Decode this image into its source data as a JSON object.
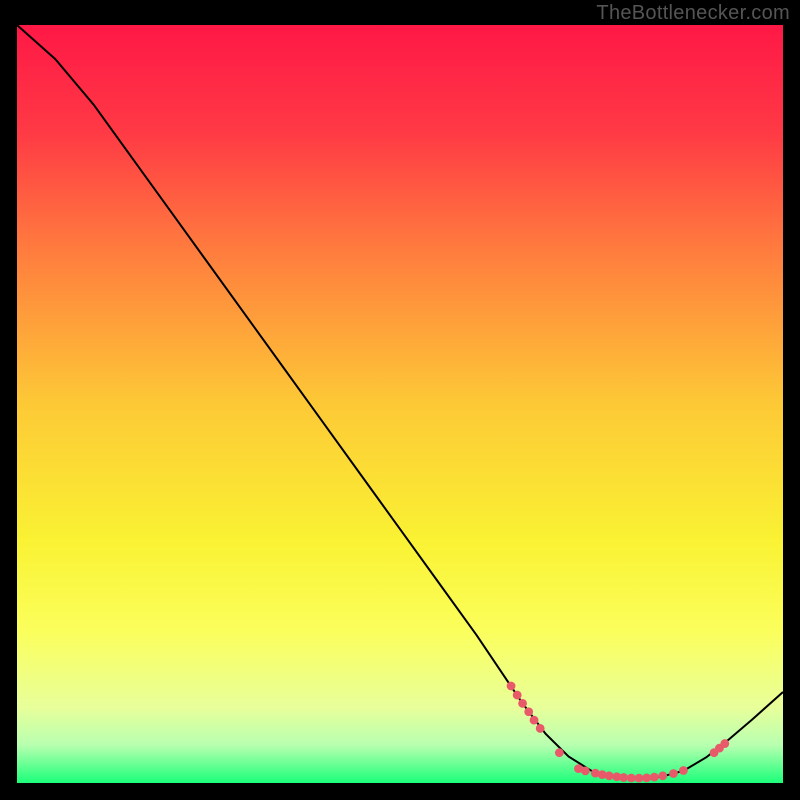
{
  "watermark": "TheBottlenecker.com",
  "chart_data": {
    "type": "line",
    "title": "",
    "xlabel": "",
    "ylabel": "",
    "xlim": [
      0,
      100
    ],
    "ylim": [
      0,
      100
    ],
    "background_gradient": {
      "stops": [
        {
          "offset": 0.0,
          "color": "#ff1846"
        },
        {
          "offset": 0.14,
          "color": "#ff3945"
        },
        {
          "offset": 0.3,
          "color": "#ff7d3e"
        },
        {
          "offset": 0.5,
          "color": "#fdc936"
        },
        {
          "offset": 0.68,
          "color": "#faf233"
        },
        {
          "offset": 0.8,
          "color": "#fbff5c"
        },
        {
          "offset": 0.9,
          "color": "#e8ff9a"
        },
        {
          "offset": 0.95,
          "color": "#b8ffb0"
        },
        {
          "offset": 1.0,
          "color": "#1bff7a"
        }
      ]
    },
    "series": [
      {
        "name": "curve",
        "color": "#000000",
        "points": [
          {
            "x": 0,
            "y": 100.0
          },
          {
            "x": 5,
            "y": 95.5
          },
          {
            "x": 10,
            "y": 89.5
          },
          {
            "x": 15,
            "y": 82.5
          },
          {
            "x": 20,
            "y": 75.5
          },
          {
            "x": 25,
            "y": 68.5
          },
          {
            "x": 30,
            "y": 61.5
          },
          {
            "x": 35,
            "y": 54.5
          },
          {
            "x": 40,
            "y": 47.5
          },
          {
            "x": 45,
            "y": 40.5
          },
          {
            "x": 50,
            "y": 33.5
          },
          {
            "x": 55,
            "y": 26.5
          },
          {
            "x": 60,
            "y": 19.5
          },
          {
            "x": 63,
            "y": 15.0
          },
          {
            "x": 66,
            "y": 10.5
          },
          {
            "x": 69,
            "y": 6.5
          },
          {
            "x": 72,
            "y": 3.5
          },
          {
            "x": 75,
            "y": 1.6
          },
          {
            "x": 78,
            "y": 0.8
          },
          {
            "x": 81,
            "y": 0.6
          },
          {
            "x": 84,
            "y": 0.8
          },
          {
            "x": 87,
            "y": 1.6
          },
          {
            "x": 90,
            "y": 3.4
          },
          {
            "x": 93,
            "y": 5.8
          },
          {
            "x": 96,
            "y": 8.4
          },
          {
            "x": 100,
            "y": 12.0
          }
        ]
      }
    ],
    "markers": {
      "color": "#e85a6a",
      "radius": 4.4,
      "points": [
        {
          "x": 64.5,
          "y": 12.8
        },
        {
          "x": 65.3,
          "y": 11.6
        },
        {
          "x": 66.0,
          "y": 10.5
        },
        {
          "x": 66.8,
          "y": 9.4
        },
        {
          "x": 67.5,
          "y": 8.3
        },
        {
          "x": 68.3,
          "y": 7.2
        },
        {
          "x": 70.8,
          "y": 4.0
        },
        {
          "x": 73.3,
          "y": 1.9
        },
        {
          "x": 74.2,
          "y": 1.6
        },
        {
          "x": 75.5,
          "y": 1.3
        },
        {
          "x": 76.4,
          "y": 1.1
        },
        {
          "x": 77.3,
          "y": 0.95
        },
        {
          "x": 78.3,
          "y": 0.82
        },
        {
          "x": 79.2,
          "y": 0.72
        },
        {
          "x": 80.2,
          "y": 0.66
        },
        {
          "x": 81.2,
          "y": 0.64
        },
        {
          "x": 82.2,
          "y": 0.68
        },
        {
          "x": 83.2,
          "y": 0.78
        },
        {
          "x": 84.3,
          "y": 0.95
        },
        {
          "x": 85.7,
          "y": 1.25
        },
        {
          "x": 87.0,
          "y": 1.65
        },
        {
          "x": 91.0,
          "y": 4.0
        },
        {
          "x": 91.7,
          "y": 4.6
        },
        {
          "x": 92.4,
          "y": 5.2
        }
      ]
    }
  }
}
